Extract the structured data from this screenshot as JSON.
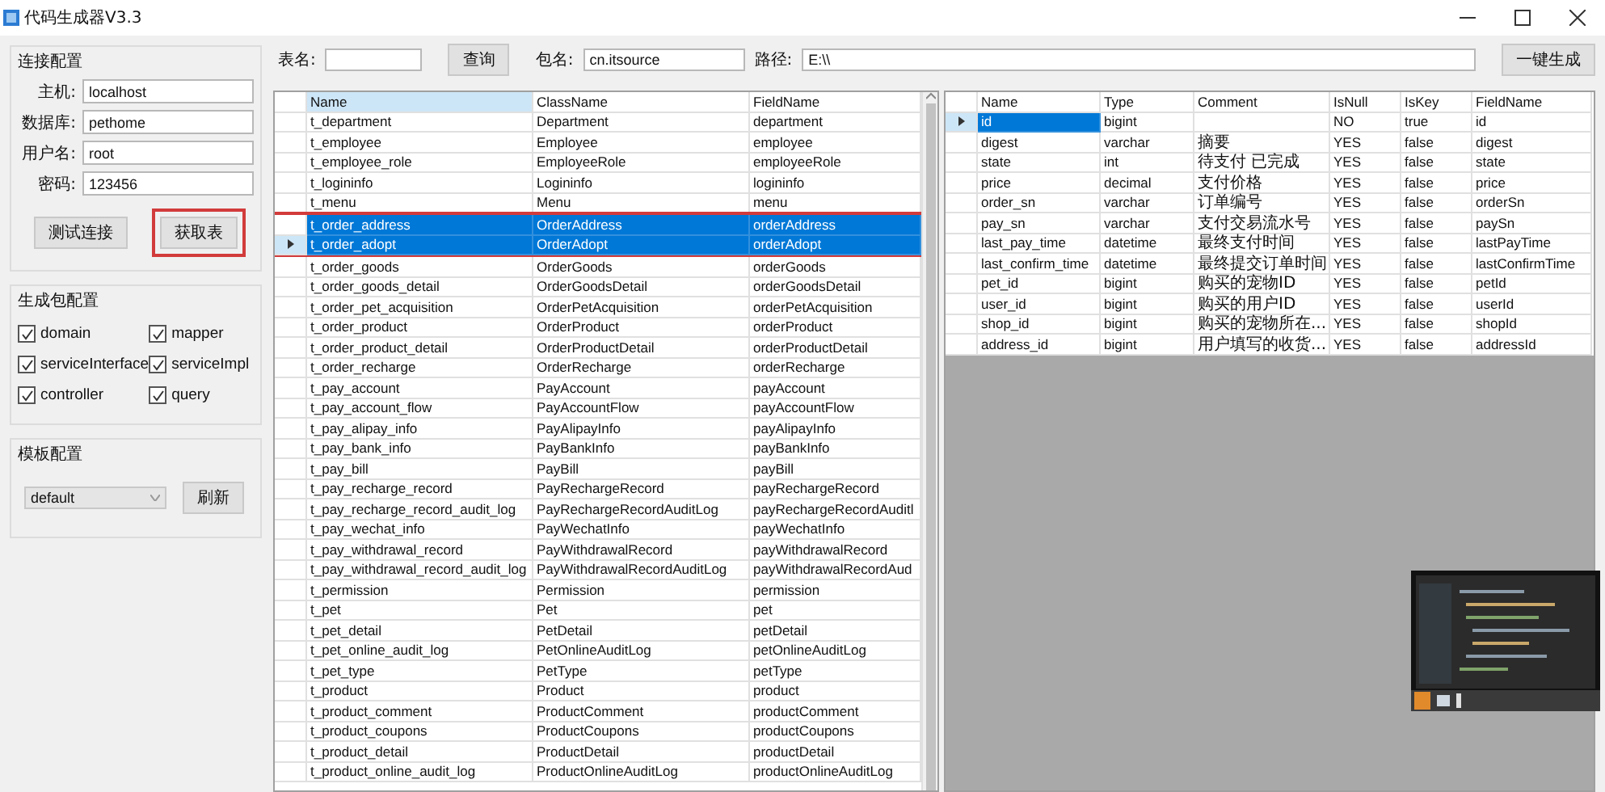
{
  "window": {
    "title": "代码生成器V3.3"
  },
  "connection": {
    "title": "连接配置",
    "fields": [
      {
        "label": "主机:",
        "value": "localhost"
      },
      {
        "label": "数据库:",
        "value": "pethome"
      },
      {
        "label": "用户名:",
        "value": "root"
      },
      {
        "label": "密码:",
        "value": "123456"
      }
    ],
    "buttons": [
      {
        "label": "测试连接",
        "marked": false
      },
      {
        "label": "获取表",
        "marked": true
      }
    ]
  },
  "package": {
    "title": "生成包配置",
    "options": [
      {
        "label": "domain",
        "checked": true
      },
      {
        "label": "mapper",
        "checked": true
      },
      {
        "label": "serviceInterface",
        "checked": true
      },
      {
        "label": "serviceImpl",
        "checked": true
      },
      {
        "label": "controller",
        "checked": true
      },
      {
        "label": "query",
        "checked": true
      }
    ]
  },
  "template": {
    "title": "模板配置",
    "value": "default",
    "button": "刷新"
  },
  "toolbar": {
    "table_label": "表名:",
    "query_button": "查询",
    "package_label": "包名:",
    "package_value": "cn.itsource",
    "path_label": "路径:",
    "path_value": "E:\\\\",
    "generate_button": "一键生成"
  },
  "tables_table": {
    "columns": [
      "Name",
      "ClassName",
      "FieldName"
    ],
    "rows": [
      {
        "cells": [
          "t_department",
          "Department",
          "department"
        ],
        "selected": false,
        "current": false,
        "marked": false
      },
      {
        "cells": [
          "t_employee",
          "Employee",
          "employee"
        ],
        "selected": false,
        "current": false,
        "marked": false
      },
      {
        "cells": [
          "t_employee_role",
          "EmployeeRole",
          "employeeRole"
        ],
        "selected": false,
        "current": false,
        "marked": false
      },
      {
        "cells": [
          "t_logininfo",
          "Logininfo",
          "logininfo"
        ],
        "selected": false,
        "current": false,
        "marked": false
      },
      {
        "cells": [
          "t_menu",
          "Menu",
          "menu"
        ],
        "selected": false,
        "current": false,
        "marked": false
      },
      {
        "cells": [
          "t_order_address",
          "OrderAddress",
          "orderAddress"
        ],
        "selected": true,
        "current": false,
        "marked": true
      },
      {
        "cells": [
          "t_order_adopt",
          "OrderAdopt",
          "orderAdopt"
        ],
        "selected": true,
        "current": true,
        "marked": true
      },
      {
        "cells": [
          "t_order_goods",
          "OrderGoods",
          "orderGoods"
        ],
        "selected": false,
        "current": false,
        "marked": false
      },
      {
        "cells": [
          "t_order_goods_detail",
          "OrderGoodsDetail",
          "orderGoodsDetail"
        ],
        "selected": false,
        "current": false,
        "marked": false
      },
      {
        "cells": [
          "t_order_pet_acquisition",
          "OrderPetAcquisition",
          "orderPetAcquisition"
        ],
        "selected": false,
        "current": false,
        "marked": false
      },
      {
        "cells": [
          "t_order_product",
          "OrderProduct",
          "orderProduct"
        ],
        "selected": false,
        "current": false,
        "marked": false
      },
      {
        "cells": [
          "t_order_product_detail",
          "OrderProductDetail",
          "orderProductDetail"
        ],
        "selected": false,
        "current": false,
        "marked": false
      },
      {
        "cells": [
          "t_order_recharge",
          "OrderRecharge",
          "orderRecharge"
        ],
        "selected": false,
        "current": false,
        "marked": false
      },
      {
        "cells": [
          "t_pay_account",
          "PayAccount",
          "payAccount"
        ],
        "selected": false,
        "current": false,
        "marked": false
      },
      {
        "cells": [
          "t_pay_account_flow",
          "PayAccountFlow",
          "payAccountFlow"
        ],
        "selected": false,
        "current": false,
        "marked": false
      },
      {
        "cells": [
          "t_pay_alipay_info",
          "PayAlipayInfo",
          "payAlipayInfo"
        ],
        "selected": false,
        "current": false,
        "marked": false
      },
      {
        "cells": [
          "t_pay_bank_info",
          "PayBankInfo",
          "payBankInfo"
        ],
        "selected": false,
        "current": false,
        "marked": false
      },
      {
        "cells": [
          "t_pay_bill",
          "PayBill",
          "payBill"
        ],
        "selected": false,
        "current": false,
        "marked": false
      },
      {
        "cells": [
          "t_pay_recharge_record",
          "PayRechargeRecord",
          "payRechargeRecord"
        ],
        "selected": false,
        "current": false,
        "marked": false
      },
      {
        "cells": [
          "t_pay_recharge_record_audit_log",
          "PayRechargeRecordAuditLog",
          "payRechargeRecordAuditl"
        ],
        "selected": false,
        "current": false,
        "marked": false
      },
      {
        "cells": [
          "t_pay_wechat_info",
          "PayWechatInfo",
          "payWechatInfo"
        ],
        "selected": false,
        "current": false,
        "marked": false
      },
      {
        "cells": [
          "t_pay_withdrawal_record",
          "PayWithdrawalRecord",
          "payWithdrawalRecord"
        ],
        "selected": false,
        "current": false,
        "marked": false
      },
      {
        "cells": [
          "t_pay_withdrawal_record_audit_log",
          "PayWithdrawalRecordAuditLog",
          "payWithdrawalRecordAud"
        ],
        "selected": false,
        "current": false,
        "marked": false
      },
      {
        "cells": [
          "t_permission",
          "Permission",
          "permission"
        ],
        "selected": false,
        "current": false,
        "marked": false
      },
      {
        "cells": [
          "t_pet",
          "Pet",
          "pet"
        ],
        "selected": false,
        "current": false,
        "marked": false
      },
      {
        "cells": [
          "t_pet_detail",
          "PetDetail",
          "petDetail"
        ],
        "selected": false,
        "current": false,
        "marked": false
      },
      {
        "cells": [
          "t_pet_online_audit_log",
          "PetOnlineAuditLog",
          "petOnlineAuditLog"
        ],
        "selected": false,
        "current": false,
        "marked": false
      },
      {
        "cells": [
          "t_pet_type",
          "PetType",
          "petType"
        ],
        "selected": false,
        "current": false,
        "marked": false
      },
      {
        "cells": [
          "t_product",
          "Product",
          "product"
        ],
        "selected": false,
        "current": false,
        "marked": false
      },
      {
        "cells": [
          "t_product_comment",
          "ProductComment",
          "productComment"
        ],
        "selected": false,
        "current": false,
        "marked": false
      },
      {
        "cells": [
          "t_product_coupons",
          "ProductCoupons",
          "productCoupons"
        ],
        "selected": false,
        "current": false,
        "marked": false
      },
      {
        "cells": [
          "t_product_detail",
          "ProductDetail",
          "productDetail"
        ],
        "selected": false,
        "current": false,
        "marked": false
      },
      {
        "cells": [
          "t_product_online_audit_log",
          "ProductOnlineAuditLog",
          "productOnlineAuditLog"
        ],
        "selected": false,
        "current": false,
        "marked": false
      }
    ]
  },
  "fields_table": {
    "columns": [
      "Name",
      "Type",
      "Comment",
      "IsNull",
      "IsKey",
      "FieldName"
    ],
    "rows": [
      {
        "cells": [
          "id",
          "bigint",
          null,
          "NO",
          "true",
          "id"
        ],
        "selected": true,
        "current": true
      },
      {
        "cells": [
          "digest",
          "varchar",
          "摘要",
          "YES",
          "false",
          "digest"
        ],
        "selected": false,
        "current": false
      },
      {
        "cells": [
          "state",
          "int",
          "待支付 已完成",
          "YES",
          "false",
          "state"
        ],
        "selected": false,
        "current": false
      },
      {
        "cells": [
          "price",
          "decimal",
          "支付价格",
          "YES",
          "false",
          "price"
        ],
        "selected": false,
        "current": false
      },
      {
        "cells": [
          "order_sn",
          "varchar",
          "订单编号",
          "YES",
          "false",
          "orderSn"
        ],
        "selected": false,
        "current": false
      },
      {
        "cells": [
          "pay_sn",
          "varchar",
          "支付交易流水号",
          "YES",
          "false",
          "paySn"
        ],
        "selected": false,
        "current": false
      },
      {
        "cells": [
          "last_pay_time",
          "datetime",
          "最终支付时间",
          "YES",
          "false",
          "lastPayTime"
        ],
        "selected": false,
        "current": false
      },
      {
        "cells": [
          "last_confirm_time",
          "datetime",
          "最终提交订单时间",
          "YES",
          "false",
          "lastConfirmTime"
        ],
        "selected": false,
        "current": false
      },
      {
        "cells": [
          "pet_id",
          "bigint",
          "购买的宠物ID",
          "YES",
          "false",
          "petId"
        ],
        "selected": false,
        "current": false
      },
      {
        "cells": [
          "user_id",
          "bigint",
          "购买的用户ID",
          "YES",
          "false",
          "userId"
        ],
        "selected": false,
        "current": false
      },
      {
        "cells": [
          "shop_id",
          "bigint",
          "购买的宠物所在...",
          "YES",
          "false",
          "shopId"
        ],
        "selected": false,
        "current": false
      },
      {
        "cells": [
          "address_id",
          "bigint",
          "用户填写的收货...",
          "YES",
          "false",
          "addressId"
        ],
        "selected": false,
        "current": false
      }
    ]
  }
}
